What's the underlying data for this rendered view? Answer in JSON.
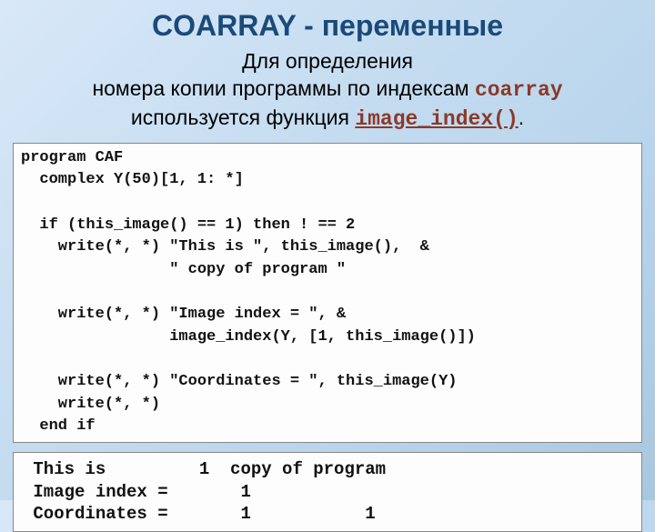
{
  "slide": {
    "title": "COARRAY - переменные",
    "desc_line1": "Для определения",
    "desc_line2a": "номера копии программы по индексам ",
    "desc_coarray": "coarray",
    "desc_line3a": "используется функция ",
    "desc_func": "image_index()",
    "desc_line3b": "."
  },
  "code": {
    "l1": "program CAF",
    "l2": "  complex Y(50)[1, 1: *]",
    "l3": "",
    "l4": "  if (this_image() == 1) then ! == 2",
    "l5": "    write(*, *) \"This is \", this_image(),  &",
    "l6": "                \" copy of program \"",
    "l7": "",
    "l8": "    write(*, *) \"Image index = \", &",
    "l9": "                image_index(Y, [1, this_image()])",
    "l10": "",
    "l11": "    write(*, *) \"Coordinates = \", this_image(Y)",
    "l12": "    write(*, *)",
    "l13": "  end if"
  },
  "output": {
    "l1": " This is         1  copy of program",
    "l2": " Image index =       1",
    "l3": " Coordinates =       1           1"
  }
}
